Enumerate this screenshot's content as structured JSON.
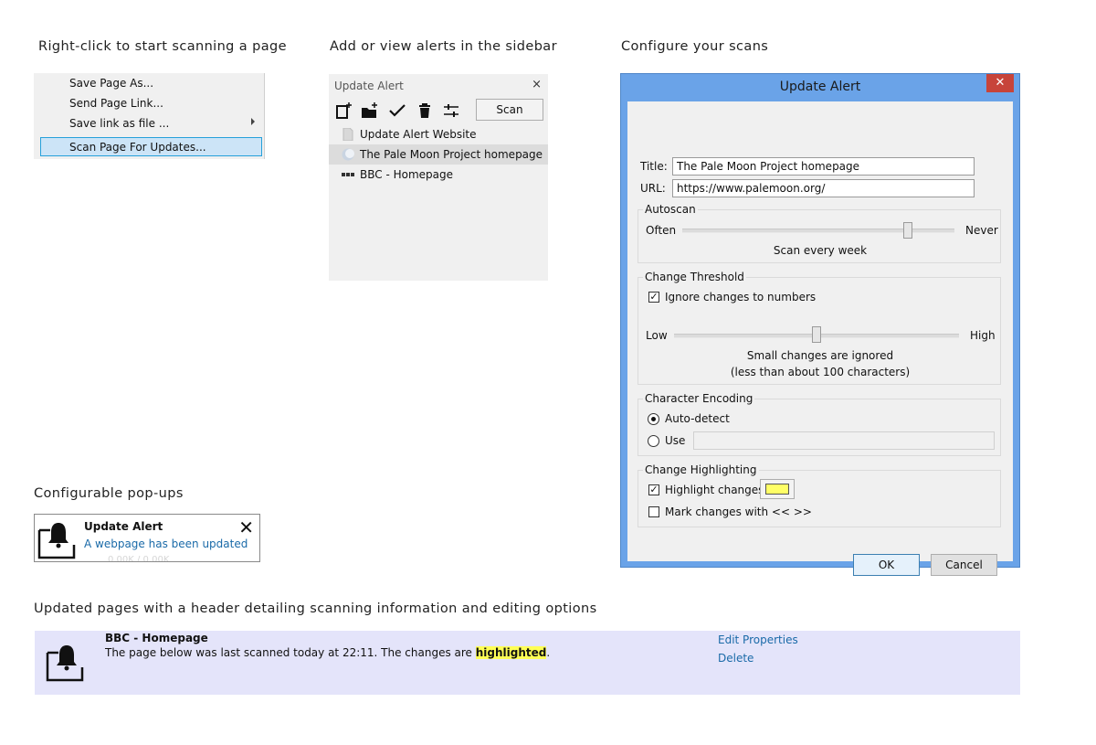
{
  "captions": {
    "context": "Right-click to start scanning a page",
    "sidebar": "Add or view alerts in the sidebar",
    "configure": "Configure your scans",
    "popups": "Configurable pop-ups",
    "header": "Updated pages with a header detailing scanning information and editing options"
  },
  "context_menu": {
    "items": [
      "Save Page As...",
      "Send Page Link...",
      "Save link as file ...",
      "Scan Page For Updates..."
    ],
    "selected_index": 3
  },
  "sidebar": {
    "title": "Update Alert",
    "close": "×",
    "toolbar_icons": [
      "new-alert-icon",
      "new-folder-icon",
      "checkmark-icon",
      "trash-icon",
      "settings-sliders-icon"
    ],
    "scan_button": "Scan",
    "items": [
      {
        "label": "Update Alert Website",
        "icon": "page-icon"
      },
      {
        "label": "The Pale Moon Project homepage",
        "icon": "moon-globe-icon",
        "selected": true
      },
      {
        "label": "BBC - Homepage",
        "icon": "bbc-icon"
      }
    ]
  },
  "dialog": {
    "title": "Update Alert",
    "close": "✕",
    "title_label": "Title:",
    "title_value": "The Pale Moon Project homepage",
    "url_label": "URL:",
    "url_value": "https://www.palemoon.org/",
    "autoscan": {
      "group": "Autoscan",
      "left": "Often",
      "right": "Never",
      "caption": "Scan every week",
      "level": 0.83
    },
    "threshold": {
      "group": "Change Threshold",
      "ignore_numbers": "Ignore changes to numbers",
      "ignore_numbers_checked": true,
      "left": "Low",
      "right": "High",
      "caption1": "Small changes are ignored",
      "caption2": "(less than about 100 characters)",
      "level": 0.5
    },
    "encoding": {
      "group": "Character Encoding",
      "auto": "Auto-detect",
      "use": "Use",
      "auto_selected": true,
      "use_value": ""
    },
    "highlighting": {
      "group": "Change Highlighting",
      "highlight": "Highlight changes",
      "highlight_checked": true,
      "highlight_color": "#ffff66",
      "mark": "Mark changes with << >>",
      "mark_checked": false
    },
    "ok": "OK",
    "cancel": "Cancel"
  },
  "popup": {
    "title": "Update Alert",
    "message": "A webpage has been updated",
    "close": "✕",
    "ghost": "0.00K / 0.00K"
  },
  "header_bar": {
    "title": "BBC - Homepage",
    "text_before": "The page below was last scanned today at 22:11. The changes are ",
    "highlight_word": "highlighted",
    "text_after": ".",
    "edit": "Edit Properties",
    "delete": "Delete"
  },
  "colors": {
    "dialog_frame": "#6aa3e8",
    "close_red": "#c7443a",
    "header_bg": "#e4e4fa",
    "link": "#1a6aa8",
    "highlight": "#ffff55",
    "menu_selection": "#cce4f7"
  }
}
